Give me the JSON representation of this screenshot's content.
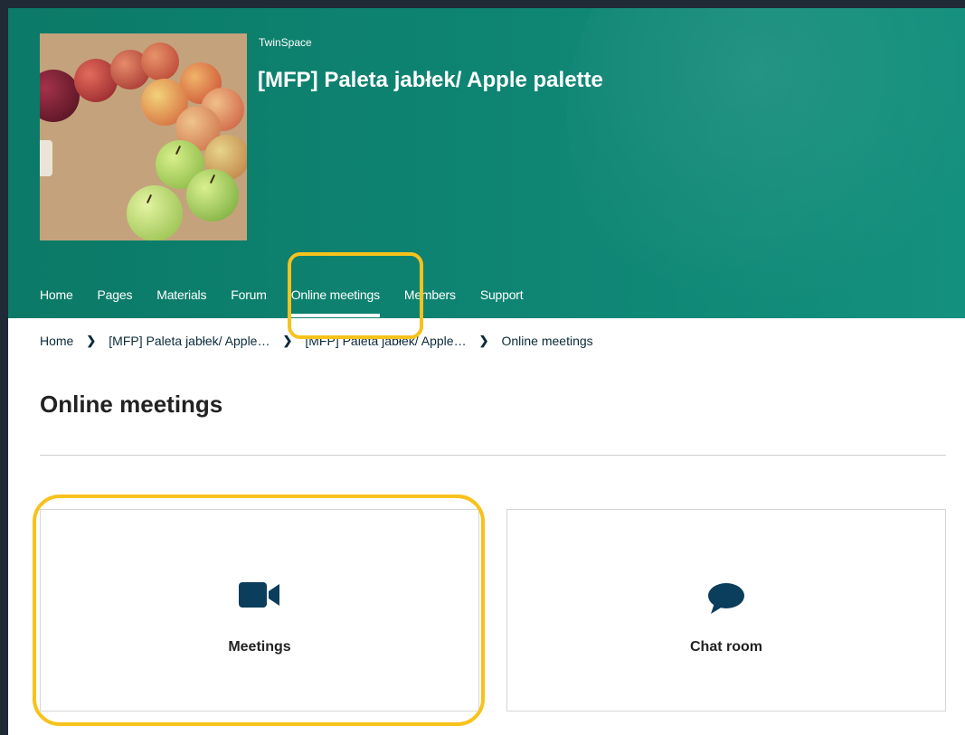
{
  "header": {
    "brand": "TwinSpace",
    "title": "[MFP] Paleta jabłek/ Apple palette"
  },
  "nav": {
    "items": [
      {
        "label": "Home"
      },
      {
        "label": "Pages"
      },
      {
        "label": "Materials"
      },
      {
        "label": "Forum"
      },
      {
        "label": "Online meetings",
        "active": true
      },
      {
        "label": "Members"
      },
      {
        "label": "Support"
      }
    ]
  },
  "breadcrumb": [
    "Home",
    "[MFP] Paleta jabłek/ Apple…",
    "[MFP] Paleta jabłek/ Apple…",
    "Online meetings"
  ],
  "page": {
    "heading": "Online meetings"
  },
  "cards": [
    {
      "label": "Meetings",
      "icon": "video-camera-icon"
    },
    {
      "label": "Chat room",
      "icon": "speech-bubble-icon"
    }
  ],
  "colors": {
    "header_green": "#0f8574",
    "highlight": "#f7c21c",
    "icon_navy": "#0b3d5c"
  }
}
